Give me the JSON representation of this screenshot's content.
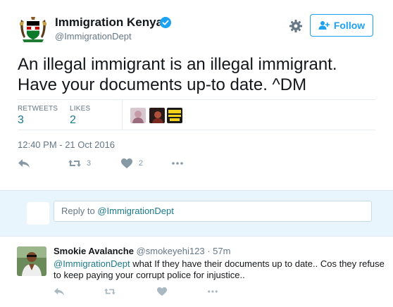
{
  "tweet": {
    "author_name": "Immigration Kenya",
    "author_handle": "@ImmigrationDept",
    "verified_icon": "verified-badge-icon",
    "follow_label": "Follow",
    "text_line1": "An illegal immigrant is an illegal immigrant.",
    "text_line2": "Have your documents up-to date. ^DM",
    "retweets_label": "RETWEETS",
    "retweets_count": "3",
    "likes_label": "LIKES",
    "likes_count": "2",
    "timestamp": "12:40 PM - 21 Oct 2016",
    "action_retweet_count": "3",
    "action_like_count": "2"
  },
  "reply_box": {
    "prefix": "Reply to ",
    "mention": "@ImmigrationDept"
  },
  "reply": {
    "author_name": "Smokie Avalanche",
    "author_handle": "@smokeyehi123",
    "separator": " · ",
    "time": "57m",
    "mention": "@ImmigrationDept",
    "text": " what If they have their documents up to date.. Cos they refuse to keep paying your corrupt police for injustice.."
  },
  "colors": {
    "accent": "#1da1f2",
    "link": "#1b7a8b",
    "muted": "#657786",
    "reply_bg": "#e8f5fd"
  }
}
